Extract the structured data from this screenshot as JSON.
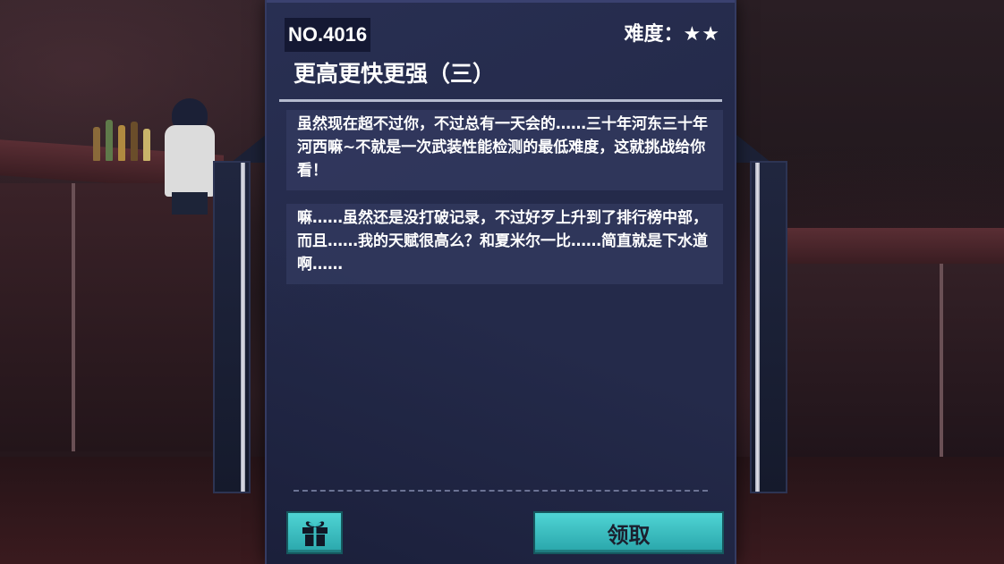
{
  "quest": {
    "number": "NO.4016",
    "difficulty_label": "难度：",
    "difficulty_stars": "★★",
    "title": "更高更快更强（三）"
  },
  "dialogs": [
    {
      "text": "虽然现在超不过你，不过总有一天会的……三十年河东三十年河西嘛~不就是一次武装性能检测的最低难度，这就挑战给你看！"
    },
    {
      "text": "嘛……虽然还是没打破记录，不过好歹上升到了排行榜中部，而且……我的天赋很高么？和夏米尔一比……简直就是下水道啊……"
    }
  ],
  "buttons": {
    "gift_icon": "gift-icon",
    "claim_label": "领取"
  },
  "colors": {
    "card_bg": "#242a4a",
    "button_teal": "#3bbfc2",
    "text": "#ffffff"
  }
}
